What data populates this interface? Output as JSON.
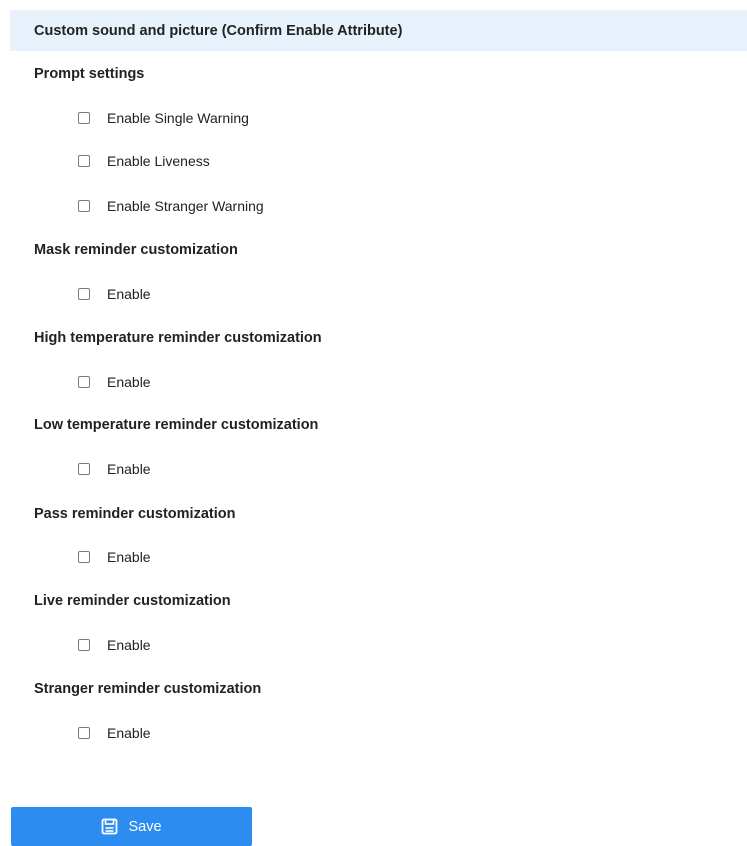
{
  "header": {
    "title": "Custom sound and picture (Confirm Enable Attribute)"
  },
  "sections": [
    {
      "title": "Prompt settings",
      "options": [
        {
          "label": "Enable Single Warning",
          "checked": false
        },
        {
          "label": "Enable Liveness",
          "checked": false
        },
        {
          "label": "Enable Stranger Warning",
          "checked": false
        }
      ]
    },
    {
      "title": "Mask reminder customization",
      "options": [
        {
          "label": "Enable",
          "checked": false
        }
      ]
    },
    {
      "title": "High temperature reminder customization",
      "options": [
        {
          "label": "Enable",
          "checked": false
        }
      ]
    },
    {
      "title": "Low temperature reminder customization",
      "options": [
        {
          "label": "Enable",
          "checked": false
        }
      ]
    },
    {
      "title": "Pass reminder customization",
      "options": [
        {
          "label": "Enable",
          "checked": false
        }
      ]
    },
    {
      "title": "Live reminder customization",
      "options": [
        {
          "label": "Enable",
          "checked": false
        }
      ]
    },
    {
      "title": "Stranger reminder customization",
      "options": [
        {
          "label": "Enable",
          "checked": false
        }
      ]
    }
  ],
  "footer": {
    "save_label": "Save",
    "save_icon": "save-icon",
    "accent_color": "#2d8cf0"
  }
}
